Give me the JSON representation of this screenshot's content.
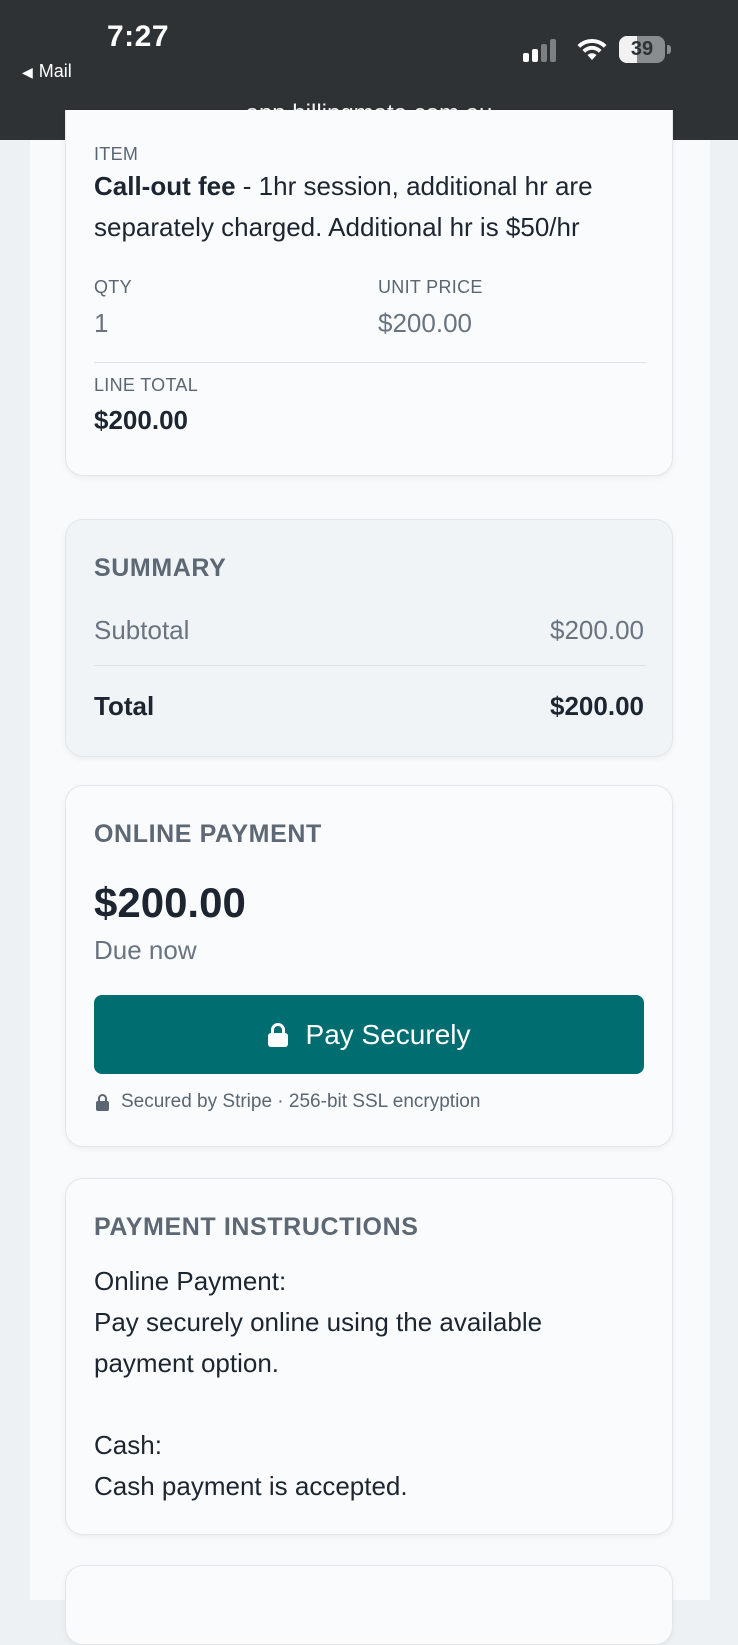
{
  "status_bar": {
    "time": "7:27",
    "back_app": "Mail",
    "battery": "39",
    "battery_level": 0.39
  },
  "address_bar": {
    "url": "app.billingmate.com.au"
  },
  "line_item": {
    "item_label": "ITEM",
    "item_name": "Call-out fee",
    "item_description": " - 1hr session, additional hr are separately charged. Additional hr is $50/hr",
    "qty_label": "QTY",
    "qty_value": "1",
    "unit_price_label": "UNIT PRICE",
    "unit_price_value": "$200.00",
    "line_total_label": "LINE TOTAL",
    "line_total_value": "$200.00"
  },
  "summary": {
    "heading": "SUMMARY",
    "subtotal_label": "Subtotal",
    "subtotal_value": "$200.00",
    "total_label": "Total",
    "total_value": "$200.00"
  },
  "online_payment": {
    "heading": "ONLINE PAYMENT",
    "amount": "$200.00",
    "due_text": "Due now",
    "pay_button_label": "Pay Securely",
    "security_note": "Secured by Stripe · 256-bit SSL encryption",
    "accent_color": "#006d71"
  },
  "payment_instructions": {
    "heading": "PAYMENT INSTRUCTIONS",
    "online_title": "Online Payment:",
    "online_text": "Pay securely online using the available payment option.",
    "cash_title": "Cash:",
    "cash_text": "Cash payment is accepted."
  }
}
